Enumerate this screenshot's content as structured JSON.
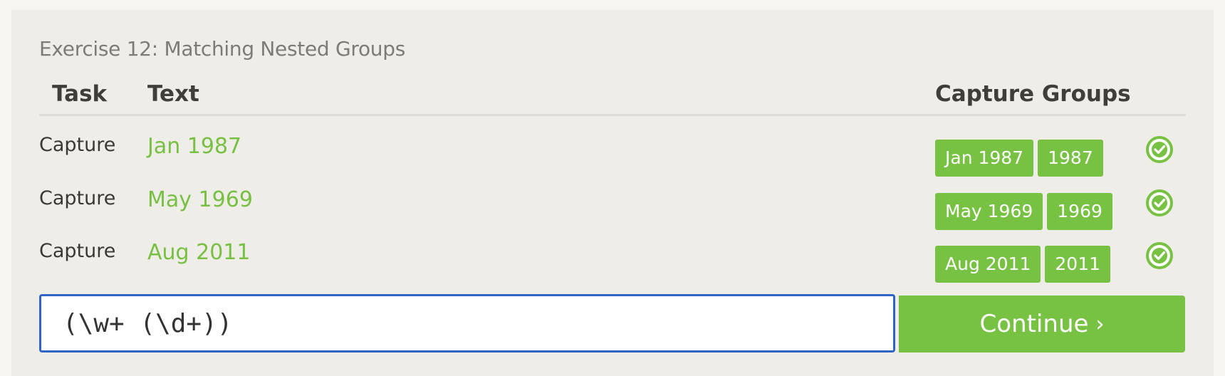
{
  "exercise": {
    "title": "Exercise 12: Matching Nested Groups"
  },
  "table": {
    "headers": {
      "task": "Task",
      "text": "Text",
      "capture_groups": "Capture Groups"
    },
    "rows": [
      {
        "task": "Capture",
        "text": "Jan 1987",
        "groups": [
          "Jan 1987",
          "1987"
        ],
        "status": "check-icon"
      },
      {
        "task": "Capture",
        "text": "May 1969",
        "groups": [
          "May 1969",
          "1969"
        ],
        "status": "check-icon"
      },
      {
        "task": "Capture",
        "text": "Aug 2011",
        "groups": [
          "Aug 2011",
          "2011"
        ],
        "status": "check-icon"
      }
    ]
  },
  "input": {
    "value": "(\\w+ (\\d+))"
  },
  "continue": {
    "label": "Continue",
    "icon": "chevron-right-icon",
    "glyph": "›"
  },
  "colors": {
    "accent_green": "#77c143",
    "focus_blue": "#2f64c4",
    "panel": "#efede7"
  }
}
